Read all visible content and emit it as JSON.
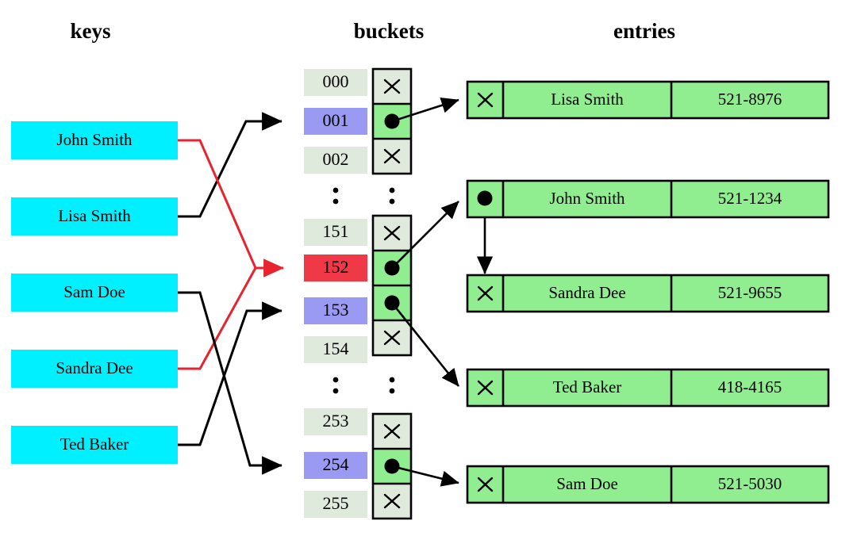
{
  "headers": {
    "keys": "keys",
    "buckets": "buckets",
    "entries": "entries"
  },
  "colors": {
    "key_box_fill": "#00f0ff",
    "bucket_index_fill": "#dfe9dc",
    "bucket_index_highlight_blue": "#9a9af2",
    "bucket_index_highlight_red": "#ef3946",
    "bucket_pointer_empty_fill": "#dfe9dc",
    "bucket_pointer_filled_fill": "#90ee90",
    "entry_fill": "#90ee90",
    "link_black": "#000000",
    "link_red": "#e8222f",
    "stroke": "#000000",
    "background": "#ffffff"
  },
  "keys": [
    {
      "label": "John Smith",
      "target_bucket": "152",
      "link_color": "red"
    },
    {
      "label": "Lisa Smith",
      "target_bucket": "001",
      "link_color": "black"
    },
    {
      "label": "Sam Doe",
      "target_bucket": "254",
      "link_color": "black"
    },
    {
      "label": "Sandra Dee",
      "target_bucket": "152",
      "link_color": "red"
    },
    {
      "label": "Ted Baker",
      "target_bucket": "153",
      "link_color": "black"
    }
  ],
  "buckets": [
    {
      "index": "000",
      "highlight": "none",
      "pointer": "null"
    },
    {
      "index": "001",
      "highlight": "blue",
      "pointer": "filled"
    },
    {
      "index": "002",
      "highlight": "none",
      "pointer": "null"
    },
    {
      "index": "⋮",
      "highlight": "ellipsis",
      "pointer": "ellipsis"
    },
    {
      "index": "151",
      "highlight": "none",
      "pointer": "null"
    },
    {
      "index": "152",
      "highlight": "red",
      "pointer": "filled"
    },
    {
      "index": "153",
      "highlight": "blue",
      "pointer": "filled"
    },
    {
      "index": "154",
      "highlight": "none",
      "pointer": "null"
    },
    {
      "index": "⋮",
      "highlight": "ellipsis",
      "pointer": "ellipsis"
    },
    {
      "index": "253",
      "highlight": "none",
      "pointer": "null"
    },
    {
      "index": "254",
      "highlight": "blue",
      "pointer": "filled"
    },
    {
      "index": "255",
      "highlight": "none",
      "pointer": "null"
    }
  ],
  "entries": [
    {
      "next": "null",
      "name": "Lisa Smith",
      "value": "521-8976",
      "from_bucket": "001"
    },
    {
      "next": "filled",
      "name": "John Smith",
      "value": "521-1234",
      "from_bucket": "152"
    },
    {
      "next": "null",
      "name": "Sandra Dee",
      "value": "521-9655",
      "from_bucket": "152"
    },
    {
      "next": "null",
      "name": "Ted Baker",
      "value": "418-4165",
      "from_bucket": "153"
    },
    {
      "next": "null",
      "name": "Sam Doe",
      "value": "521-5030",
      "from_bucket": "254"
    }
  ],
  "icons": {
    "null_pointer": "x-cross-icon",
    "filled_pointer": "filled-dot-icon",
    "ellipsis": "vertical-ellipsis-icon",
    "arrow": "arrowhead-icon"
  }
}
